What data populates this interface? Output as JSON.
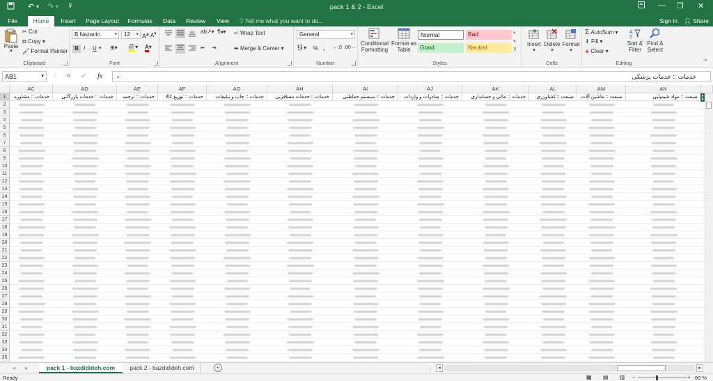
{
  "window": {
    "title": "pack 1 & 2 - Excel"
  },
  "tabs": [
    "File",
    "Home",
    "Insert",
    "Page Layout",
    "Formulas",
    "Data",
    "Review",
    "View"
  ],
  "tell_me": "Tell me what you want to do...",
  "sign_in": "Sign in",
  "share": "Share",
  "clipboard": {
    "paste": "Paste",
    "cut": "Cut",
    "copy": "Copy",
    "format_painter": "Format Painter",
    "label": "Clipboard"
  },
  "font": {
    "name": "B Nazanin",
    "size": "12",
    "label": "Font",
    "bold": "B",
    "italic": "I",
    "underline": "U"
  },
  "alignment": {
    "wrap": "Wrap Text",
    "merge": "Merge & Center",
    "label": "Alignment"
  },
  "number": {
    "format": "General",
    "label": "Number",
    "percent": "%",
    "comma": ","
  },
  "styles": {
    "cond": "Conditional Formatting",
    "table": "Format as Table",
    "normal": "Normal",
    "bad": "Bad",
    "good": "Good",
    "neutral": "Neutral",
    "label": "Styles"
  },
  "cells": {
    "insert": "Insert",
    "delete": "Delete",
    "format": "Format",
    "label": "Cells"
  },
  "editing": {
    "autosum": "AutoSum",
    "fill": "Fill",
    "clear": "Clear",
    "sort": "Sort & Filter",
    "find": "Find & Select",
    "label": "Editing"
  },
  "formula_bar": {
    "name_box": "AB1",
    "content": "خدمات :: خدمات پزشکی",
    "fx": "fx"
  },
  "columns": [
    {
      "letter": "AC",
      "header": "خدمات :: مشاوره"
    },
    {
      "letter": "AD",
      "header": "خدمات :: خدمات بازرگانی"
    },
    {
      "letter": "AE",
      "header": "خدمات :: ترجمه"
    },
    {
      "letter": "AF",
      "header": "خدمات :: توزیع کالا"
    },
    {
      "letter": "AG",
      "header": "خدمات :: چاپ و تبلیغات"
    },
    {
      "letter": "AH",
      "header": "خدمات :: خدمات مسافرتی"
    },
    {
      "letter": "AI",
      "header": "خدمات :: سیستم حفاظتی"
    },
    {
      "letter": "AJ",
      "header": "خدمات :: صادرات و واردات"
    },
    {
      "letter": "AK",
      "header": "خدمات :: مالی و حسابداری"
    },
    {
      "letter": "AL",
      "header": "صنعت :: کشاورزی"
    },
    {
      "letter": "AM",
      "header": "صنعت :: ماشین آلات"
    },
    {
      "letter": "AN",
      "header": "صنعت :: مواد شیمیایی"
    },
    {
      "letter": "",
      "header": "صنعتی"
    }
  ],
  "rows": [
    "1",
    "2",
    "3",
    "4",
    "5",
    "6",
    "7",
    "8",
    "9",
    "10",
    "11",
    "12",
    "13",
    "14",
    "15",
    "16",
    "17",
    "18",
    "19",
    "20",
    "21",
    "22",
    "23",
    "24",
    "25",
    "26",
    "27",
    "28",
    "29",
    "30",
    "31",
    "32",
    "33",
    "34",
    "35"
  ],
  "sheets": [
    "pack 1 - bazdidideh.com",
    "pack 2 - bazdidideh.com"
  ],
  "status": {
    "ready": "Ready",
    "zoom": "80 %"
  },
  "colors": {
    "accent": "#217346",
    "bad_bg": "#ffc7ce",
    "bad_fg": "#9c0006",
    "good_bg": "#c6efce",
    "good_fg": "#006100",
    "neutral_bg": "#ffeb9c",
    "neutral_fg": "#9c5700"
  }
}
